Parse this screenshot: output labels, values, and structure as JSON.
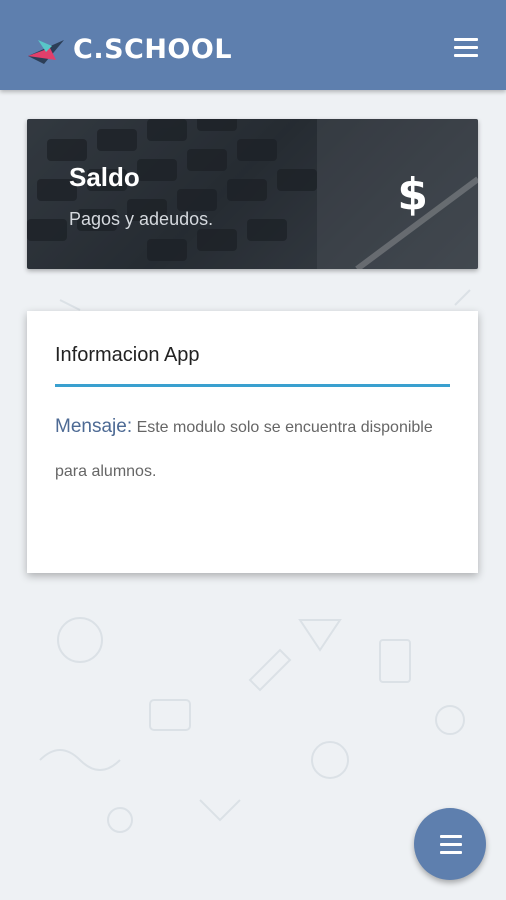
{
  "header": {
    "brand": "C.SCHOOL",
    "menu_icon": "hamburger-icon",
    "background_color": "#5e7fae"
  },
  "balance_card": {
    "title": "Saldo",
    "subtitle": "Pagos y adeudos.",
    "icon": "$"
  },
  "info_card": {
    "title": "Informacion App",
    "message_label": "Mensaje:",
    "message_text": "Este modulo solo se encuentra disponible para alumnos.",
    "accent_color": "#3aa0cf"
  },
  "fab": {
    "icon": "hamburger-icon"
  }
}
